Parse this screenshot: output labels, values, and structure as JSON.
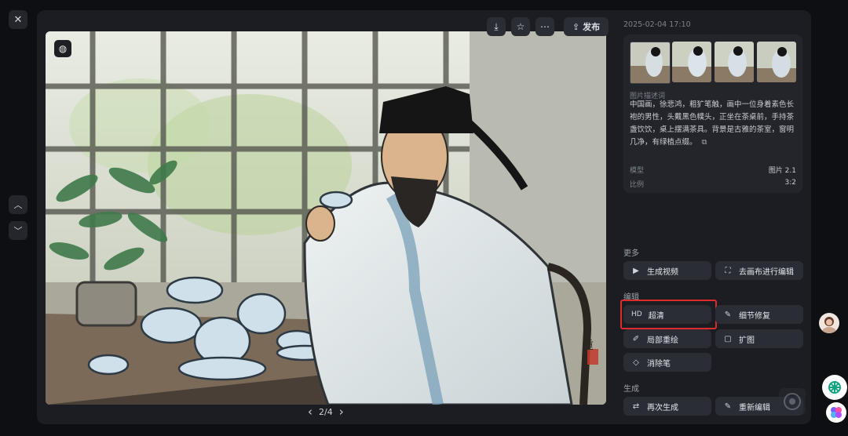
{
  "close_icon": "✕",
  "nav": {
    "up_icon": "︿",
    "down_icon": "﹀"
  },
  "image": {
    "watermark_icon": "◍",
    "seal_text": "重"
  },
  "toolbar": {
    "download_icon": "⤓",
    "favorite_icon": "☆",
    "more_icon": "⋯",
    "publish_icon": "⇪",
    "publish_label": "发布"
  },
  "pager": {
    "prev_icon": "‹",
    "label": "2/4",
    "next_icon": "›"
  },
  "details": {
    "timestamp": "2025-02-04 17:10",
    "desc_label": "图片描述词",
    "description": "中国画，徐悲鸿，粗犷笔触，画中一位身着素色长袍的男性，头戴黑色幞头，正坐在茶桌前，手持茶盏饮饮，桌上摆满茶具。背景是古雅的茶室，窗明几净，有绿植点缀。",
    "copy_icon": "⧉",
    "model_label": "模型",
    "model_value": "图片 2.1",
    "ratio_label": "比例",
    "ratio_value": "3:2"
  },
  "sections": {
    "more": "更多",
    "edit": "编辑",
    "generate": "生成"
  },
  "buttons": {
    "gen_video": {
      "icon": "▶",
      "label": "生成视频"
    },
    "canvas_edit": {
      "icon": "⛶",
      "label": "去画布进行编辑"
    },
    "hd": {
      "icon": "HD",
      "label": "超清"
    },
    "detail_fix": {
      "icon": "✎",
      "label": "细节修复"
    },
    "inpaint": {
      "icon": "✐",
      "label": "局部重绘"
    },
    "expand": {
      "icon": "▢",
      "label": "扩图"
    },
    "eraser": {
      "icon": "◇",
      "label": "消除笔"
    },
    "regenerate": {
      "icon": "⇄",
      "label": "再次生成"
    },
    "re_edit": {
      "icon": "✎",
      "label": "重新编辑"
    }
  },
  "colors": {
    "accent_highlight": "#e02b2b",
    "panel": "#1b1d22",
    "button": "#2a2d33"
  }
}
